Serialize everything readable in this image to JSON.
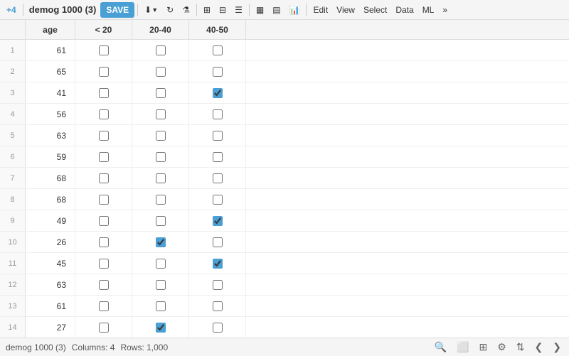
{
  "toolbar": {
    "add_label": "+4",
    "title": "demog 1000 (3)",
    "save_label": "SAVE",
    "edit_label": "Edit",
    "view_label": "View",
    "select_label": "Select",
    "data_label": "Data",
    "ml_label": "ML"
  },
  "columns": {
    "row_num": "",
    "age": "age",
    "lt20": "< 20",
    "c2040": "20-40",
    "c4050": "40-50"
  },
  "rows": [
    {
      "num": 1,
      "age": 61,
      "lt20": false,
      "c2040": false,
      "c4050": false
    },
    {
      "num": 2,
      "age": 65,
      "lt20": false,
      "c2040": false,
      "c4050": false
    },
    {
      "num": 3,
      "age": 41,
      "lt20": false,
      "c2040": false,
      "c4050": true
    },
    {
      "num": 4,
      "age": 56,
      "lt20": false,
      "c2040": false,
      "c4050": false
    },
    {
      "num": 5,
      "age": 63,
      "lt20": false,
      "c2040": false,
      "c4050": false
    },
    {
      "num": 6,
      "age": 59,
      "lt20": false,
      "c2040": false,
      "c4050": false
    },
    {
      "num": 7,
      "age": 68,
      "lt20": false,
      "c2040": false,
      "c4050": false
    },
    {
      "num": 8,
      "age": 68,
      "lt20": false,
      "c2040": false,
      "c4050": false
    },
    {
      "num": 9,
      "age": 49,
      "lt20": false,
      "c2040": false,
      "c4050": true
    },
    {
      "num": 10,
      "age": 26,
      "lt20": false,
      "c2040": true,
      "c4050": false
    },
    {
      "num": 11,
      "age": 45,
      "lt20": false,
      "c2040": false,
      "c4050": true
    },
    {
      "num": 12,
      "age": 63,
      "lt20": false,
      "c2040": false,
      "c4050": false
    },
    {
      "num": 13,
      "age": 61,
      "lt20": false,
      "c2040": false,
      "c4050": false
    },
    {
      "num": 14,
      "age": 27,
      "lt20": false,
      "c2040": true,
      "c4050": false
    }
  ],
  "statusbar": {
    "dataset": "demog 1000 (3)",
    "columns": "Columns: 4",
    "rows": "Rows: 1,000"
  }
}
